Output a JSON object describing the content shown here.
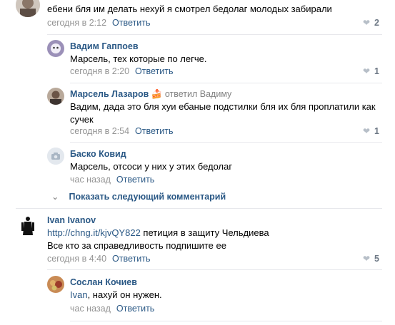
{
  "comments": [
    {
      "text": "ебени бля им делать нехуй я смотрел бедолаг молодых забирали",
      "time": "сегодня в 2:12",
      "reply": "Ответить",
      "likes": "2"
    },
    {
      "author": "Вадим Гаппоев",
      "text": "Марсель, тех которые по легче.",
      "time": "сегодня в 2:20",
      "reply": "Ответить",
      "likes": "1"
    },
    {
      "author": "Марсель Лазаров",
      "replied": "ответил Вадиму",
      "text1": "Вадим, дада это бля хуи ебаные подстилки бля их бля проплатили как",
      "text2": "сучек",
      "time": "сегодня в 2:54",
      "reply": "Ответить",
      "likes": "1"
    },
    {
      "author": "Баско Ковид",
      "text": "Марсель, отсоси у них у этих бедолаг",
      "time": "час назад",
      "reply": "Ответить"
    },
    {
      "author": "Ivan Ivanov",
      "link": "http://chng.it/kjvQY822",
      "text1_rest": " петиция в защиту Чельдиева",
      "text2": "Все кто за справедливость подпишите ее",
      "time": "сегодня в 4:40",
      "reply": "Ответить",
      "likes": "5"
    },
    {
      "author": "Сослан Кочиев",
      "mention": "Ivan",
      "text_rest": ", нахуй он нужен.",
      "time": "час назад",
      "reply": "Ответить"
    }
  ],
  "show_more": "Показать следующий комментарий",
  "icons": {
    "heart": "heart-icon",
    "chevron": "chevron-down-icon",
    "camera": "camera-icon"
  },
  "colors": {
    "link": "#2a5885",
    "meta": "#939393",
    "divider": "#e7e8ec"
  }
}
